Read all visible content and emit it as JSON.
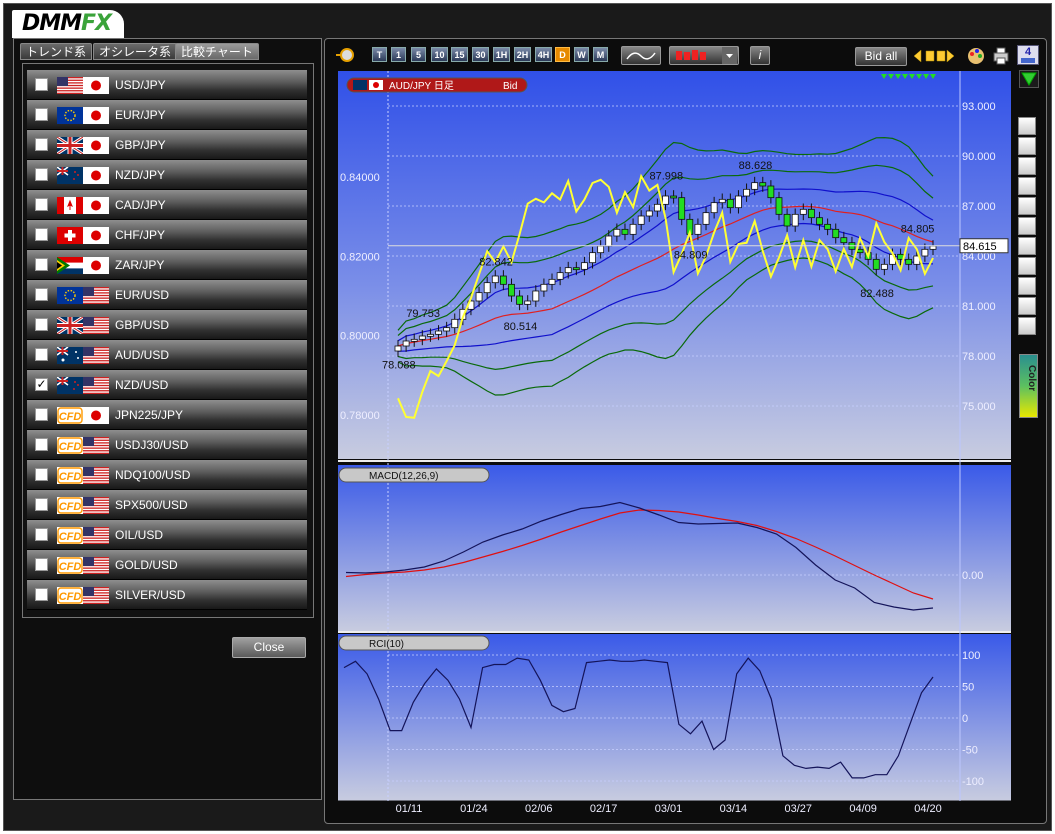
{
  "logo": {
    "dmm": "DMM",
    "fx": "FX"
  },
  "left_tabs": [
    "トレンド系",
    "オシレータ系",
    "比較チャート"
  ],
  "pairs": [
    {
      "label": "USD/JPY",
      "checked": false,
      "flags": [
        "us",
        "jp"
      ]
    },
    {
      "label": "EUR/JPY",
      "checked": false,
      "flags": [
        "eu",
        "jp"
      ]
    },
    {
      "label": "GBP/JPY",
      "checked": false,
      "flags": [
        "gb",
        "jp"
      ]
    },
    {
      "label": "NZD/JPY",
      "checked": false,
      "flags": [
        "nz",
        "jp"
      ]
    },
    {
      "label": "CAD/JPY",
      "checked": false,
      "flags": [
        "ca",
        "jp"
      ]
    },
    {
      "label": "CHF/JPY",
      "checked": false,
      "flags": [
        "ch",
        "jp"
      ]
    },
    {
      "label": "ZAR/JPY",
      "checked": false,
      "flags": [
        "za",
        "jp"
      ]
    },
    {
      "label": "EUR/USD",
      "checked": false,
      "flags": [
        "eu",
        "us"
      ]
    },
    {
      "label": "GBP/USD",
      "checked": false,
      "flags": [
        "gb",
        "us"
      ]
    },
    {
      "label": "AUD/USD",
      "checked": false,
      "flags": [
        "au",
        "us"
      ]
    },
    {
      "label": "NZD/USD",
      "checked": true,
      "flags": [
        "nz",
        "us"
      ]
    },
    {
      "label": "JPN225/JPY",
      "checked": false,
      "flags": [
        "cfd",
        "jp"
      ]
    },
    {
      "label": "USDJ30/USD",
      "checked": false,
      "flags": [
        "cfd",
        "us"
      ]
    },
    {
      "label": "NDQ100/USD",
      "checked": false,
      "flags": [
        "cfd",
        "us"
      ]
    },
    {
      "label": "SPX500/USD",
      "checked": false,
      "flags": [
        "cfd",
        "us"
      ]
    },
    {
      "label": "OIL/USD",
      "checked": false,
      "flags": [
        "cfd",
        "us"
      ]
    },
    {
      "label": "GOLD/USD",
      "checked": false,
      "flags": [
        "cfd",
        "us"
      ]
    },
    {
      "label": "SILVER/USD",
      "checked": false,
      "flags": [
        "cfd",
        "us"
      ]
    }
  ],
  "cfd_label": "CFD",
  "close_label": "Close",
  "toolbar": {
    "timeframes": [
      "T",
      "1",
      "5",
      "10",
      "15",
      "30",
      "1H",
      "2H",
      "4H",
      "D",
      "W",
      "M"
    ],
    "active_timeframe": "D",
    "info_label": "i",
    "bid_all": "Bid all",
    "screen_count": "4"
  },
  "main_chip": {
    "symbol": "AUD/JPY 日足",
    "side": "Bid"
  },
  "macd_chip": "MACD(12,26,9)",
  "rci_chip": "RCI(10)",
  "color_label": "Color",
  "current_price": "84.615",
  "colors": {
    "accent_orange": "#e68a00",
    "candle_up": "#ffffff",
    "candle_down": "#22dd22",
    "compare_line": "#ffff33",
    "ma_red": "#e02020",
    "band_blue": "#1010cc",
    "band_green": "#0a6a0a",
    "macd_signal": "#e01010",
    "macd_line": "#14145a"
  },
  "chart_data": [
    {
      "type": "line",
      "name": "AUD/JPY daily candles with Bollinger bands and NZD/USD comparison",
      "x_ticks": [
        "01/11",
        "01/24",
        "02/06",
        "02/17",
        "03/01",
        "03/14",
        "03/27",
        "04/09",
        "04/20"
      ],
      "y_left_ticks": [
        "0.84000",
        "0.82000",
        "0.80000",
        "0.78000"
      ],
      "y_left_values": [
        0.84,
        0.82,
        0.8,
        0.78
      ],
      "y_right_ticks": [
        "93.000",
        "90.000",
        "87.000",
        "84.000",
        "81.000",
        "78.000",
        "75.000"
      ],
      "y_right_values": [
        93,
        90,
        87,
        84,
        81,
        78,
        75
      ],
      "annotations": [
        {
          "text": "78.088",
          "value": 78.088
        },
        {
          "text": "79.753",
          "value": 79.753
        },
        {
          "text": "82.842",
          "value": 82.842
        },
        {
          "text": "80.514",
          "value": 80.514
        },
        {
          "text": "87.998",
          "value": 87.998
        },
        {
          "text": "84.809",
          "value": 84.809
        },
        {
          "text": "88.628",
          "value": 88.628
        },
        {
          "text": "84.805",
          "value": 84.805
        },
        {
          "text": "82.488",
          "value": 82.488
        }
      ],
      "close_series": [
        78.6,
        78.9,
        79.0,
        79.2,
        79.3,
        79.5,
        79.7,
        80.2,
        80.8,
        81.3,
        81.8,
        82.4,
        82.8,
        82.3,
        81.6,
        81.1,
        81.3,
        81.9,
        82.3,
        82.6,
        83.0,
        83.3,
        83.2,
        83.6,
        84.2,
        84.6,
        85.2,
        85.6,
        85.3,
        85.9,
        86.4,
        86.7,
        87.1,
        87.6,
        87.5,
        86.2,
        85.3,
        85.9,
        86.6,
        87.2,
        87.4,
        86.9,
        87.6,
        88.0,
        88.4,
        88.2,
        87.5,
        86.5,
        85.8,
        86.5,
        86.8,
        86.3,
        85.9,
        85.6,
        85.1,
        84.8,
        84.4,
        84.2,
        83.8,
        83.2,
        83.5,
        84.1,
        83.8,
        83.5,
        84.0,
        84.4,
        84.6
      ],
      "nzdusd_series": [
        0.7842,
        0.7795,
        0.7793,
        0.7858,
        0.7911,
        0.7898,
        0.7936,
        0.7976,
        0.8046,
        0.8095,
        0.8155,
        0.8213,
        0.8185,
        0.8225,
        0.8185,
        0.8256,
        0.8333,
        0.8345,
        0.8336,
        0.8359,
        0.8343,
        0.839,
        0.8313,
        0.8343,
        0.8385,
        0.8393,
        0.8375,
        0.831,
        0.8362,
        0.8324,
        0.8402,
        0.8366,
        0.838,
        0.8297,
        0.816,
        0.8206,
        0.826,
        0.8157,
        0.82,
        0.826,
        0.831,
        0.8186,
        0.8231,
        0.8234,
        0.8289,
        0.8213,
        0.8149,
        0.8197,
        0.8253,
        0.8172,
        0.8241,
        0.8174,
        0.8241,
        0.8218,
        0.8162,
        0.8219,
        0.8173,
        0.8246,
        0.82,
        0.8283,
        0.8236,
        0.8208,
        0.8165,
        0.8246,
        0.8218,
        0.8156,
        0.8196
      ]
    },
    {
      "type": "line",
      "name": "MACD(12,26,9)",
      "y_ticks": [
        "0.00"
      ],
      "series": [
        {
          "name": "MACD",
          "values": [
            0.05,
            0.04,
            0.06,
            0.1,
            0.16,
            0.28,
            0.46,
            0.66,
            0.8,
            0.92,
            1.08,
            1.21,
            1.33,
            1.37,
            1.45,
            1.34,
            1.2,
            1.05,
            1.02,
            1.03,
            1.04,
            0.95,
            0.82,
            0.55,
            0.2,
            -0.1,
            -0.26,
            -0.55,
            -0.64,
            -0.7,
            -0.66
          ]
        },
        {
          "name": "Signal",
          "values": [
            -0.03,
            0.01,
            0.04,
            0.06,
            0.1,
            0.16,
            0.25,
            0.36,
            0.47,
            0.59,
            0.72,
            0.86,
            0.99,
            1.12,
            1.24,
            1.3,
            1.29,
            1.26,
            1.2,
            1.13,
            1.07,
            0.99,
            0.87,
            0.73,
            0.56,
            0.38,
            0.19,
            0.0,
            -0.18,
            -0.36,
            -0.48
          ]
        }
      ]
    },
    {
      "type": "line",
      "name": "RCI(10)",
      "y_ticks": [
        "100",
        "50",
        "0",
        "-50",
        "-100"
      ],
      "y_values": [
        100,
        50,
        0,
        -50,
        -100
      ],
      "values": [
        80,
        90,
        70,
        30,
        -20,
        -20,
        25,
        55,
        78,
        60,
        30,
        -15,
        80,
        85,
        85,
        95,
        92,
        60,
        20,
        10,
        15,
        88,
        90,
        92,
        90,
        90,
        92,
        90,
        88,
        -10,
        -25,
        -5,
        -50,
        -35,
        70,
        95,
        75,
        30,
        -60,
        -75,
        -80,
        -78,
        -80,
        -70,
        -95,
        -95,
        -90,
        -90,
        -60,
        -10,
        40,
        65
      ]
    }
  ]
}
